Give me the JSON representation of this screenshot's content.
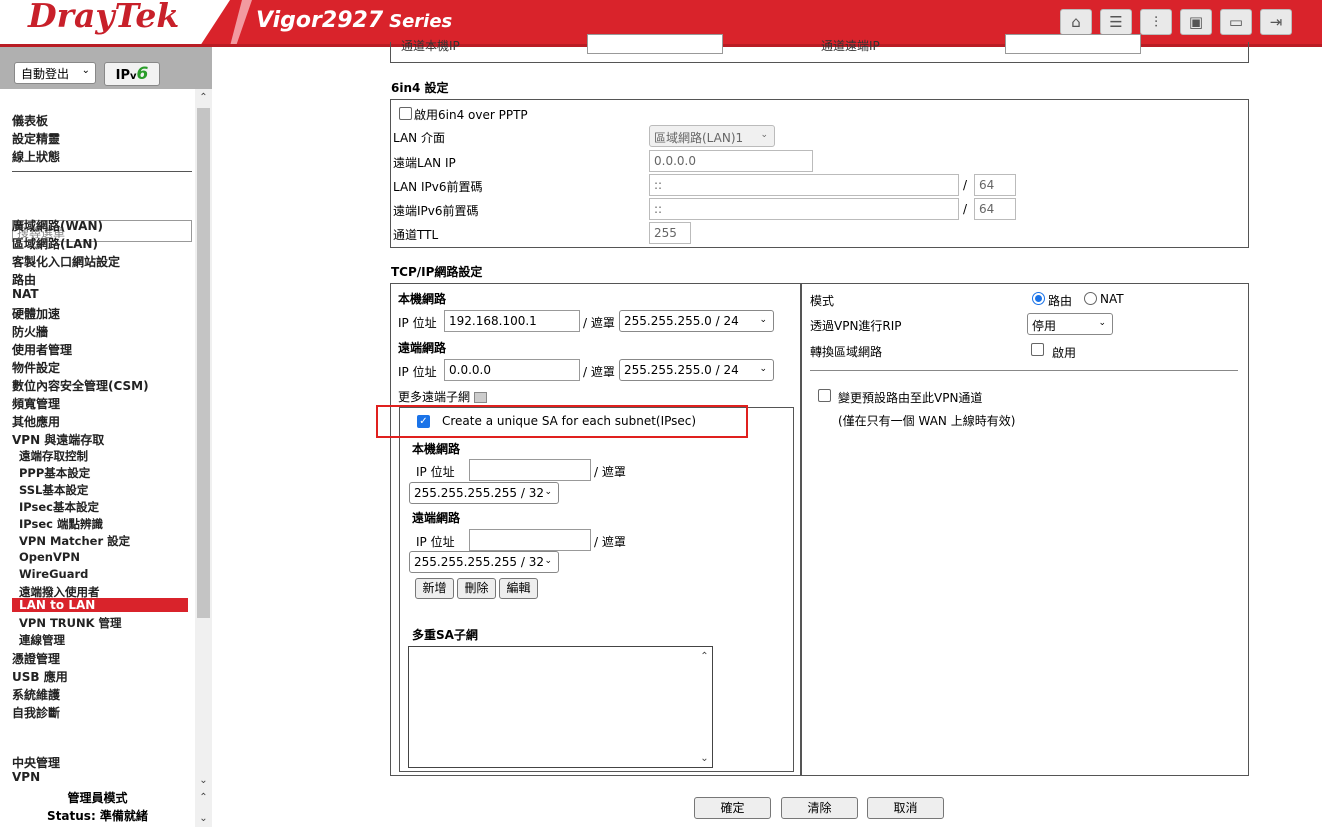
{
  "header": {
    "brand": "DrayTek",
    "model": "Vigor2927",
    "series": "Series",
    "icons": [
      "home-icon",
      "table-icon",
      "sliders-icon",
      "save-icon",
      "book-icon",
      "logout-icon"
    ]
  },
  "sidebar": {
    "logout_label": "自動登出",
    "ipv6_label_ip": "IP",
    "ipv6_label_v": "v",
    "ipv6_label_6": "6",
    "top_items": [
      "儀表板",
      "設定精靈",
      "線上狀態"
    ],
    "search_placeholder": "搜尋選單",
    "items": [
      "廣域網路(WAN)",
      "區域網路(LAN)",
      "客製化入口網站設定",
      "路由",
      "NAT",
      "硬體加速",
      "防火牆",
      "使用者管理",
      "物件設定",
      "數位內容安全管理(CSM)",
      "頻寬管理",
      "其他應用",
      "VPN 與遠端存取"
    ],
    "sub_items": [
      "遠端存取控制",
      "PPP基本設定",
      "SSL基本設定",
      "IPsec基本設定",
      "IPsec 端點辨識",
      "VPN Matcher 設定",
      "OpenVPN",
      "WireGuard",
      "遠端撥入使用者"
    ],
    "active_item": "LAN to LAN",
    "sub_items_after": [
      "VPN TRUNK 管理",
      "連線管理"
    ],
    "items_after": [
      "憑證管理",
      "USB 應用",
      "系統維護",
      "自我診斷"
    ],
    "bottom_items": [
      "中央管理",
      "VPN"
    ],
    "mode_label": "管理員模式",
    "status_label": "Status: 準備就緒"
  },
  "top_partial": {
    "left_label": "通道本機IP",
    "right_label": "通道遠端IP"
  },
  "six_in_four": {
    "title": "6in4 設定",
    "enable_label": "啟用6in4 over PPTP",
    "lan_interface_label": "LAN 介面",
    "lan_interface_value": "區域網路(LAN)1",
    "remote_lan_ip_label": "遠端LAN IP",
    "remote_lan_ip_value": "0.0.0.0",
    "lan_prefix_label": "LAN IPv6前置碼",
    "lan_prefix_value": "::",
    "lan_prefix_len": "64",
    "remote_prefix_label": "遠端IPv6前置碼",
    "remote_prefix_value": "::",
    "remote_prefix_len": "64",
    "ttl_label": "通道TTL",
    "ttl_value": "255",
    "slash": "/"
  },
  "tcpip": {
    "title": "TCP/IP網路設定",
    "local_net_label": "本機網路",
    "ip_label": "IP 位址",
    "mask_label": "/ 遮罩",
    "local_ip": "192.168.100.1",
    "local_mask": "255.255.255.0 / 24",
    "remote_net_label": "遠端網路",
    "remote_ip": "0.0.0.0",
    "remote_mask": "255.255.255.0 / 24",
    "more_subnets_label": "更多遠端子網",
    "unique_sa_label": "Create a unique SA for each subnet(IPsec)",
    "sub_local_net_label": "本機網路",
    "sub_local_ip": "",
    "sub_local_mask": "255.255.255.255 / 32",
    "sub_remote_net_label": "遠端網路",
    "sub_remote_ip": "",
    "sub_remote_mask": "255.255.255.255 / 32",
    "add_label": "新增",
    "delete_label": "刪除",
    "edit_label": "編輯",
    "multi_sa_label": "多重SA子網",
    "mode_label": "模式",
    "mode_route": "路由",
    "mode_nat": "NAT",
    "rip_label": "透過VPN進行RIP",
    "rip_value": "停用",
    "translate_label": "轉換區域網路",
    "translate_enable": "啟用",
    "change_route_label": "變更預設路由至此VPN通道",
    "change_route_note": "(僅在只有一個 WAN 上線時有效)"
  },
  "actions": {
    "ok": "確定",
    "clear": "清除",
    "cancel": "取消"
  }
}
